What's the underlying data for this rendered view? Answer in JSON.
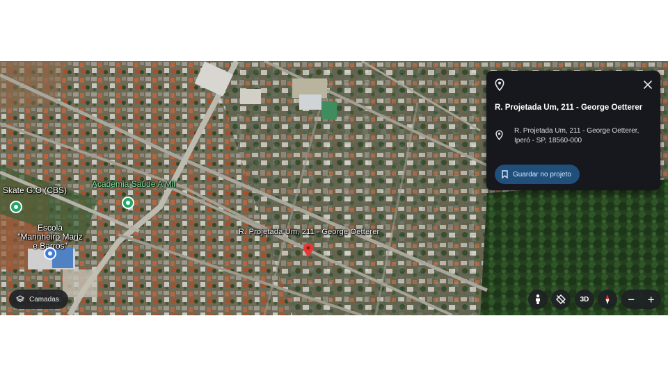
{
  "map": {
    "labels": {
      "skate": "Skate G.O (CBS)",
      "academia": "Academia Saúde A Mil",
      "escola": "Escola \"Marinheiro Mariz e Barros\"",
      "street": "R. Projetada Um, 211 - George Oetterer"
    }
  },
  "info_panel": {
    "title": "R. Projetada Um, 211 - George Oetterer",
    "address_line1": "R. Projetada Um, 211 - George Oetterer,",
    "address_line2": "Iperó - SP, 18560-000",
    "save_label": "Guardar no projeto"
  },
  "controls": {
    "layers_label": "Camadas",
    "view_3d_label": "3D",
    "zoom_out_label": "−",
    "zoom_in_label": "+"
  },
  "colors": {
    "panel_bg": "#16181d",
    "save_button_bg": "#1f4f7a",
    "poi_green": "#1fa866",
    "pin_red": "#e53935"
  },
  "icons": [
    "location-pin-icon",
    "close-icon",
    "bookmark-icon",
    "layers-icon",
    "pegman-icon",
    "tilt-off-icon",
    "compass-icon"
  ]
}
